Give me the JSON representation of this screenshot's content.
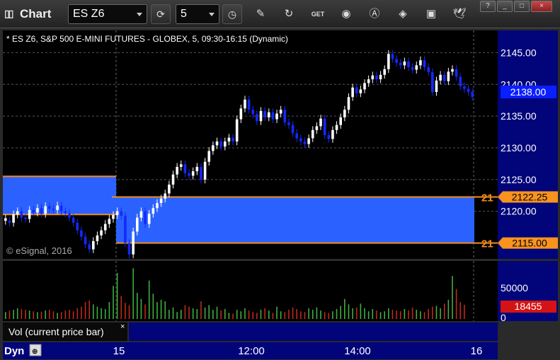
{
  "toolbar": {
    "app_title": "Chart",
    "symbol": "ES Z6",
    "interval": "5",
    "icons": [
      "refresh-icon",
      "clock-icon",
      "pencil-icon",
      "cycle-icon",
      "get-icon",
      "play-icon",
      "a-icon",
      "tag-icon",
      "comment-icon",
      "twitter-icon"
    ]
  },
  "window_buttons": [
    "?",
    "_",
    "□",
    "×"
  ],
  "chart_data": {
    "type": "candlestick",
    "title": "* ES Z6, S&P 500 E-MINI FUTURES - GLOBEX, 5, 09:30-16:15 (Dynamic)",
    "watermark": "© eSignal, 2016",
    "y_ticks": [
      "2145.00",
      "2140.00",
      "2135.00",
      "2130.00",
      "2125.00",
      "2120.00"
    ],
    "ylim": [
      2112.5,
      2148.5
    ],
    "x_ticks": [
      "15",
      "12:00",
      "14:00",
      "16"
    ],
    "last_price": "2138.00",
    "levels": [
      {
        "label": "2122.25",
        "stub": "21",
        "value": 2122.25
      },
      {
        "label": "2115.00",
        "stub": "21",
        "value": 2115.0
      }
    ],
    "zone_prev": {
      "high": 2125.5,
      "low": 2119.5
    },
    "zone_current": {
      "high": 2122.25,
      "low": 2115.0
    },
    "closes": [
      2118.5,
      2118.2,
      2119.5,
      2120.0,
      2119.0,
      2118.8,
      2120.2,
      2119.8,
      2120.5,
      2119.6,
      2120.8,
      2120.4,
      2120.2,
      2120.9,
      2120.0,
      2119.7,
      2119.0,
      2118.2,
      2117.0,
      2116.0,
      2114.8,
      2114.0,
      2115.3,
      2116.2,
      2117.0,
      2118.0,
      2118.8,
      2119.4,
      2120.0,
      2119.3,
      2115.0,
      2113.2,
      2116.8,
      2119.0,
      2120.0,
      2118.0,
      2119.6,
      2120.5,
      2121.3,
      2122.0,
      2122.8,
      2124.2,
      2125.8,
      2127.0,
      2127.4,
      2126.0,
      2125.6,
      2126.3,
      2127.0,
      2125.0,
      2127.8,
      2129.5,
      2130.4,
      2131.0,
      2130.2,
      2131.0,
      2131.6,
      2131.0,
      2134.5,
      2136.2,
      2137.6,
      2136.0,
      2135.3,
      2134.2,
      2135.8,
      2134.8,
      2135.6,
      2134.5,
      2135.4,
      2136.0,
      2134.0,
      2133.6,
      2132.3,
      2131.5,
      2131.0,
      2130.6,
      2131.5,
      2132.8,
      2133.4,
      2134.6,
      2132.0,
      2131.4,
      2132.8,
      2133.6,
      2134.8,
      2136.0,
      2138.0,
      2139.5,
      2138.6,
      2139.2,
      2140.2,
      2140.8,
      2141.4,
      2140.8,
      2141.5,
      2142.4,
      2144.8,
      2144.0,
      2143.4,
      2143.0,
      2143.6,
      2142.7,
      2142.3,
      2143.0,
      2143.8,
      2142.7,
      2141.9,
      2138.8,
      2140.6,
      2141.5,
      2140.5,
      2142.0,
      2142.4,
      2141.2,
      2139.7,
      2139.3,
      2138.8,
      2138.0
    ],
    "volume_axis": [
      "50000",
      "0"
    ],
    "last_volume": "18455",
    "volumes": [
      9000,
      11000,
      12000,
      14000,
      13000,
      12000,
      11000,
      10000,
      9000,
      9500,
      11000,
      12000,
      10000,
      8000,
      9000,
      11000,
      12000,
      10000,
      14000,
      16000,
      22000,
      24000,
      19000,
      16000,
      14000,
      13000,
      22000,
      43000,
      60000,
      30000,
      21000,
      18000,
      66000,
      34000,
      26000,
      19000,
      50000,
      33000,
      22000,
      25000,
      23000,
      12000,
      15000,
      9000,
      12000,
      18000,
      16000,
      14000,
      13000,
      23000,
      15000,
      18000,
      12000,
      16000,
      11000,
      13000,
      8000,
      7000,
      12000,
      10000,
      14000,
      11000,
      9000,
      8000,
      12000,
      14000,
      11000,
      8000,
      16000,
      10000,
      9000,
      12000,
      15000,
      13000,
      10000,
      9000,
      14000,
      12000,
      15000,
      11000,
      9000,
      8000,
      10000,
      13000,
      17000,
      26000,
      19000,
      14000,
      15000,
      20000,
      14000,
      10000,
      13000,
      11000,
      9000,
      10000,
      14000,
      12000,
      11000,
      10000,
      13000,
      11000,
      15000,
      12000,
      10000,
      9000,
      13000,
      16000,
      17000,
      14000,
      20000,
      25000,
      56000,
      39000,
      22000,
      18455
    ],
    "ups": [
      1,
      0,
      1,
      1,
      0,
      0,
      1,
      0,
      1,
      0,
      1,
      0,
      0,
      1,
      0,
      0,
      0,
      0,
      0,
      0,
      0,
      0,
      1,
      1,
      1,
      1,
      1,
      1,
      1,
      0,
      0,
      0,
      1,
      1,
      1,
      0,
      1,
      1,
      1,
      1,
      1,
      1,
      1,
      1,
      1,
      0,
      0,
      1,
      1,
      0,
      1,
      1,
      1,
      1,
      0,
      1,
      1,
      0,
      1,
      1,
      1,
      0,
      0,
      0,
      1,
      0,
      1,
      0,
      1,
      1,
      0,
      0,
      0,
      0,
      0,
      0,
      1,
      1,
      1,
      1,
      0,
      0,
      1,
      1,
      1,
      1,
      1,
      1,
      0,
      1,
      1,
      1,
      1,
      0,
      1,
      1,
      1,
      0,
      0,
      0,
      1,
      0,
      0,
      1,
      1,
      0,
      0,
      0,
      1,
      1,
      0,
      1,
      1,
      0,
      0,
      0,
      0,
      0
    ],
    "indicator_label": "Vol (current price bar)",
    "bottom_corner": "Dyn"
  }
}
